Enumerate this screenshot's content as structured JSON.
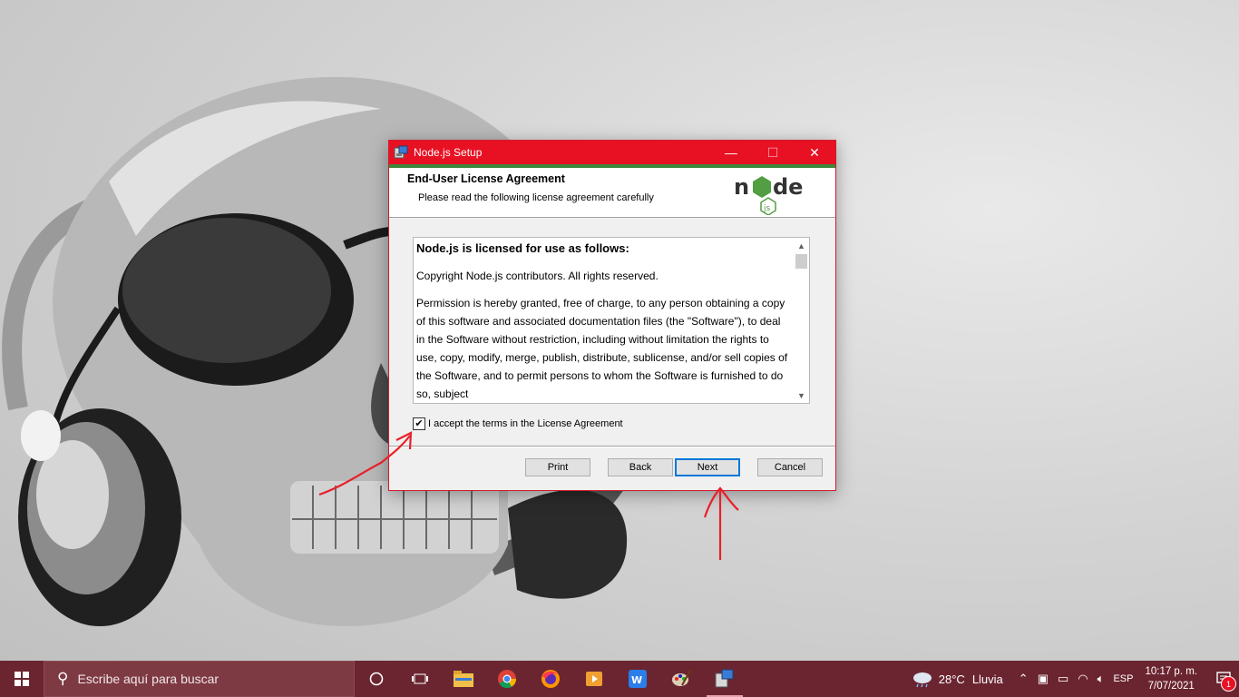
{
  "window": {
    "title": "Node.js Setup",
    "controls": {
      "minimize": "—",
      "maximize": "☐",
      "close": "✕"
    },
    "header_title": "End-User License Agreement",
    "header_subtitle": "Please read the following license agreement carefully",
    "logo": "node-js-logo",
    "license": {
      "heading": "Node.js is licensed for use as follows:",
      "paragraphs": [
        "Copyright Node.js contributors. All rights reserved.",
        "Permission is hereby granted, free of charge, to any person obtaining a copy of this software and associated documentation files (the \"Software\"), to deal in the Software without restriction, including without limitation the rights to use, copy, modify, merge, publish, distribute, sublicense, and/or sell copies of the Software, and to permit persons to whom the Software is furnished to do so, subject"
      ]
    },
    "accept_label": "I accept the terms in the License Agreement",
    "accept_checked": true,
    "buttons": {
      "print": "Print",
      "back": "Back",
      "next": "Next",
      "cancel": "Cancel"
    }
  },
  "taskbar": {
    "search_placeholder": "Escribe aquí para buscar",
    "apps": [
      "cortana-icon",
      "task-view-icon",
      "file-explorer-icon",
      "chrome-icon",
      "firefox-icon",
      "media-player-icon",
      "wps-office-icon",
      "paint-icon",
      "nodejs-setup-icon"
    ],
    "weather_temp": "28°C",
    "weather_text": "Lluvia",
    "language": "ESP",
    "time": "10:17 p. m.",
    "date": "7/07/2021",
    "notification_count": "1"
  },
  "colors": {
    "titlebar": "#e81123",
    "node_green": "#3c873a",
    "taskbar": "#6b2530",
    "annotation": "#e8202a"
  }
}
